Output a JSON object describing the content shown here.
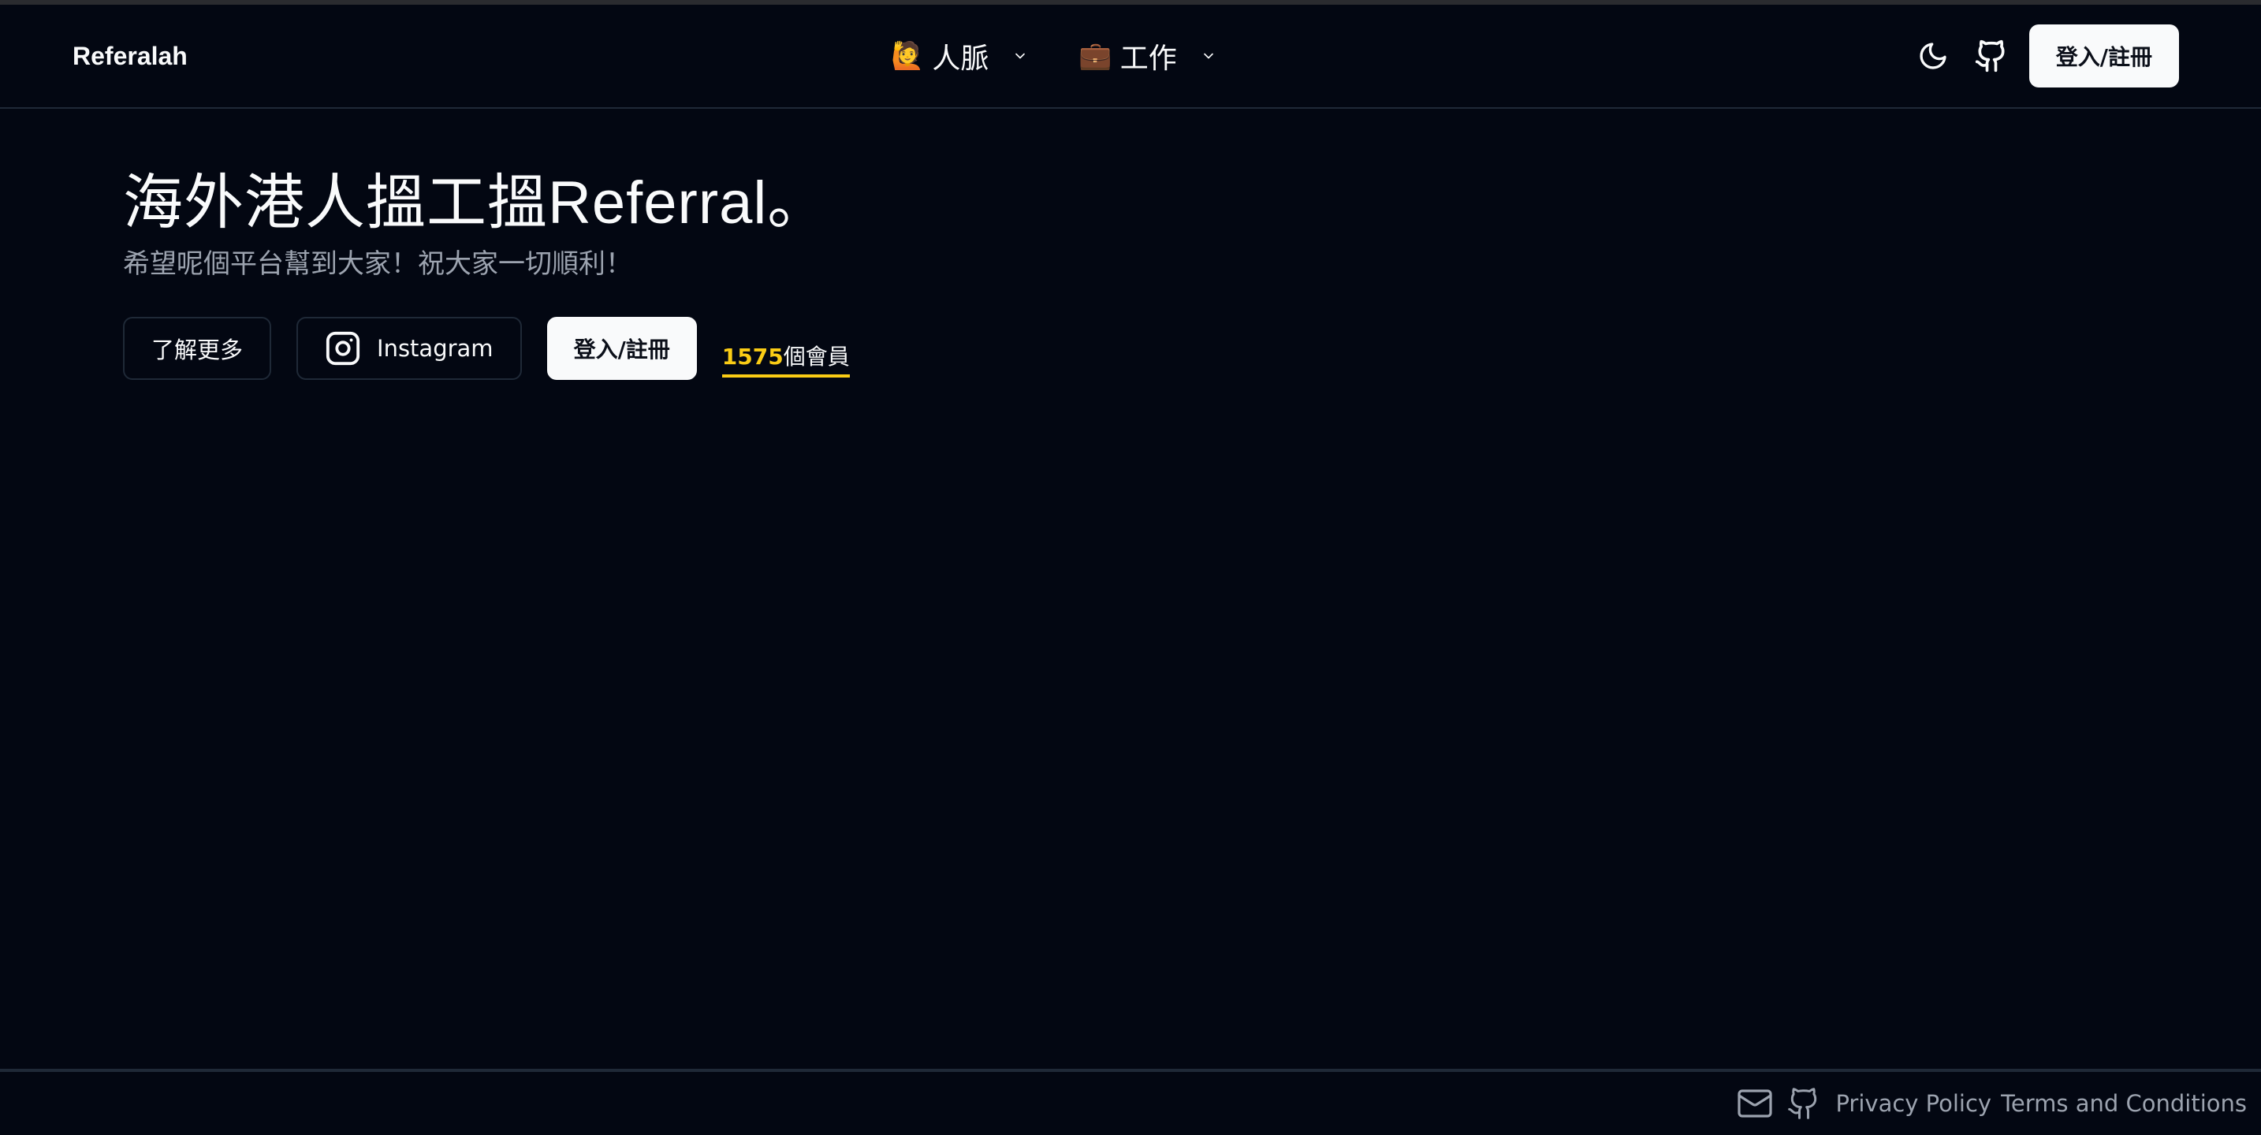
{
  "navbar": {
    "brand": "Referalah",
    "menus": [
      {
        "emoji": "🙋",
        "label": "人脈"
      },
      {
        "emoji": "💼",
        "label": "工作"
      }
    ],
    "login_label": "登入/註冊"
  },
  "hero": {
    "title": "海外港人搵工搵Referral。",
    "subtitle": "希望呢個平台幫到大家！祝大家一切順利！",
    "learn_more_label": "了解更多",
    "instagram_label": "Instagram",
    "login_label": "登入/註冊",
    "member_count": "1575",
    "member_unit": "個會員"
  },
  "footer": {
    "privacy_label": "Privacy Policy",
    "terms_label": "Terms and Conditions"
  },
  "colors": {
    "background": "#030712",
    "accent": "#facc15",
    "muted": "#9ca3af"
  }
}
